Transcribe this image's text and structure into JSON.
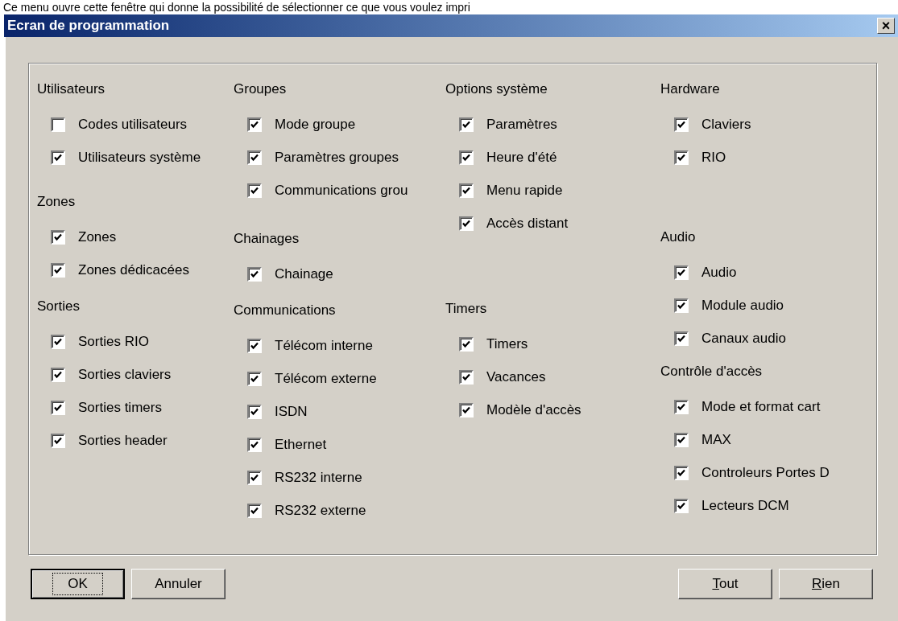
{
  "caption": "Ce menu ouvre cette fenêtre qui donne la possibilité de sélectionner ce que vous voulez impri",
  "window": {
    "title": "Ecran de programmation",
    "close": "×"
  },
  "columns": [
    {
      "sections": [
        {
          "heading": "Utilisateurs",
          "items": [
            {
              "label": "Codes utilisateurs",
              "checked": false
            },
            {
              "label": "Utilisateurs système",
              "checked": true
            }
          ]
        },
        {
          "heading": "Zones",
          "items": [
            {
              "label": "Zones",
              "checked": true
            },
            {
              "label": "Zones dédicacées",
              "checked": true
            }
          ]
        },
        {
          "heading": "Sorties",
          "items": [
            {
              "label": "Sorties RIO",
              "checked": true
            },
            {
              "label": "Sorties claviers",
              "checked": true
            },
            {
              "label": "Sorties timers",
              "checked": true
            },
            {
              "label": "Sorties header",
              "checked": true
            }
          ]
        }
      ]
    },
    {
      "sections": [
        {
          "heading": "Groupes",
          "items": [
            {
              "label": "Mode groupe",
              "checked": true
            },
            {
              "label": "Paramètres groupes",
              "checked": true
            },
            {
              "label": "Communications grou",
              "checked": true
            }
          ]
        },
        {
          "heading": "Chainages",
          "items": [
            {
              "label": "Chainage",
              "checked": true
            }
          ]
        },
        {
          "heading": "Communications",
          "items": [
            {
              "label": "Télécom interne",
              "checked": true
            },
            {
              "label": "Télécom externe",
              "checked": true
            },
            {
              "label": "ISDN",
              "checked": true
            },
            {
              "label": "Ethernet",
              "checked": true
            },
            {
              "label": "RS232 interne",
              "checked": true
            },
            {
              "label": "RS232 externe",
              "checked": true
            }
          ]
        }
      ]
    },
    {
      "sections": [
        {
          "heading": "Options système",
          "items": [
            {
              "label": "Paramètres",
              "checked": true
            },
            {
              "label": "Heure d'été",
              "checked": true
            },
            {
              "label": "Menu rapide",
              "checked": true
            },
            {
              "label": "Accès distant",
              "checked": true
            }
          ]
        },
        {
          "heading": "Timers",
          "items": [
            {
              "label": "Timers",
              "checked": true
            },
            {
              "label": "Vacances",
              "checked": true
            },
            {
              "label": "Modèle d'accès",
              "checked": true
            }
          ]
        }
      ]
    },
    {
      "sections": [
        {
          "heading": "Hardware",
          "items": [
            {
              "label": "Claviers",
              "checked": true
            },
            {
              "label": "RIO",
              "checked": true
            }
          ]
        },
        {
          "heading": "Audio",
          "items": [
            {
              "label": "Audio",
              "checked": true
            },
            {
              "label": "Module audio",
              "checked": true
            },
            {
              "label": "Canaux audio",
              "checked": true
            }
          ]
        },
        {
          "heading": "Contrôle d'accès",
          "items": [
            {
              "label": "Mode et format cart",
              "checked": true
            },
            {
              "label": "MAX",
              "checked": true
            },
            {
              "label": "Controleurs Portes D",
              "checked": true
            },
            {
              "label": "Lecteurs DCM",
              "checked": true
            }
          ]
        }
      ]
    }
  ],
  "buttons_left": [
    {
      "label": "OK",
      "default": true,
      "mnemonic": false
    },
    {
      "label": "Annuler",
      "default": false,
      "mnemonic": false
    }
  ],
  "buttons_right": [
    {
      "label": "Tout",
      "default": false,
      "mnemonic": true
    },
    {
      "label": "Rien",
      "default": false,
      "mnemonic": true
    }
  ]
}
